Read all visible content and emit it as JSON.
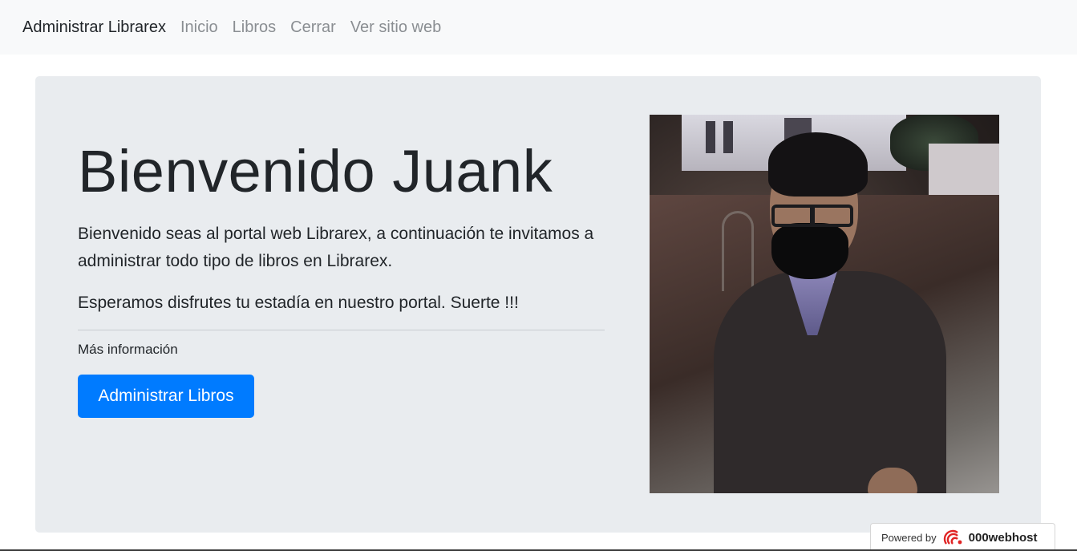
{
  "navbar": {
    "brand": "Administrar Librarex",
    "links": [
      "Inicio",
      "Libros",
      "Cerrar",
      "Ver sitio web"
    ]
  },
  "jumbotron": {
    "title": "Bienvenido Juank",
    "lead1": "Bienvenido seas al portal web Librarex, a continuación te invitamos a administrar todo tipo de libros en Librarex.",
    "lead2": "Esperamos disfrutes tu estadía en nuestro portal. Suerte !!!",
    "more_info": "Más información",
    "button_label": "Administrar Libros"
  },
  "footer_badge": {
    "powered_by": "Powered by",
    "host_name": "000webhost"
  },
  "colors": {
    "primary": "#007bff",
    "jumbotron_bg": "#e9ecef",
    "navbar_bg": "#f8f9fa",
    "nav_link": "#8a8e92"
  }
}
